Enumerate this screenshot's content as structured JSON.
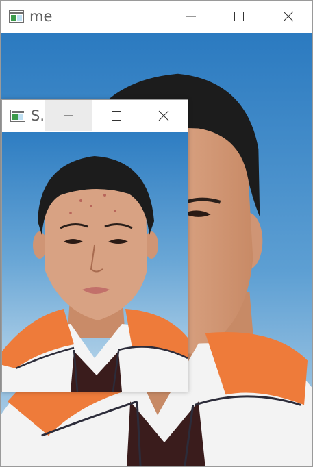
{
  "main_window": {
    "title": "me",
    "icon": "app-window-icon",
    "controls": [
      "minimize-icon",
      "maximize-icon",
      "close-icon"
    ]
  },
  "small_window": {
    "title": "S..",
    "icon": "app-window-icon",
    "controls": [
      "minimize-icon",
      "maximize-icon",
      "close-icon"
    ]
  },
  "colors": {
    "sky_top": "#2f7fc4",
    "sky_bottom": "#b9d6ea",
    "hair": "#1c1c1c",
    "skin": "#d69f7e",
    "collar_orange": "#ef7d3c",
    "shirt_white": "#f4f4f4",
    "inner_shirt": "#3a1c1c"
  }
}
